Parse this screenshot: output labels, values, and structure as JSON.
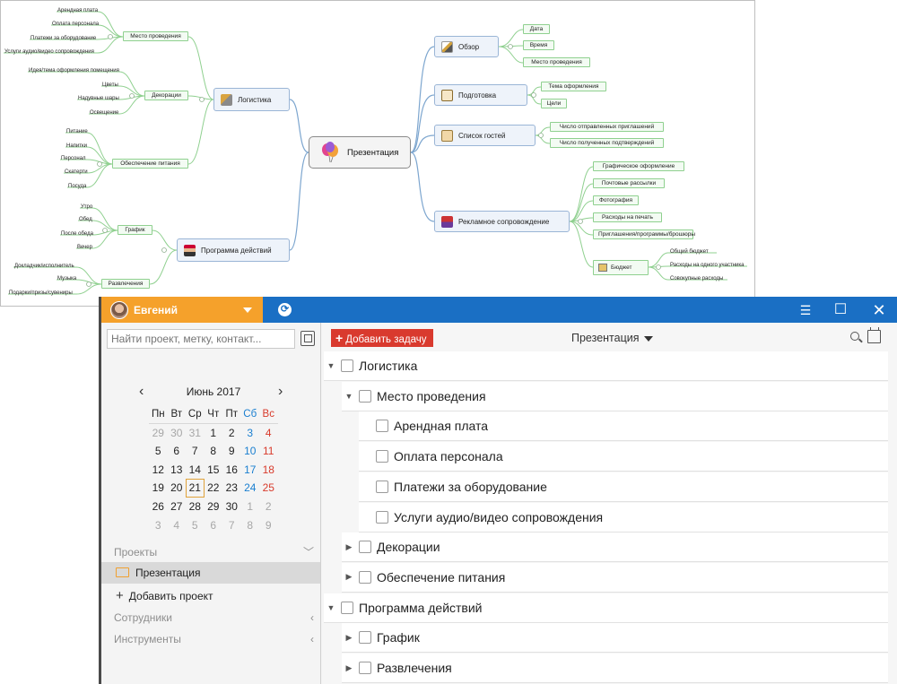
{
  "mindmap": {
    "center": "Презентация",
    "left_branches": [
      {
        "label": "Логистика",
        "groups": [
          {
            "label": "Место проведения",
            "leaves": [
              "Арендная плата",
              "Оплата персонала",
              "Платежи за оборудование",
              "Услуги аудио/видео сопровождения"
            ]
          },
          {
            "label": "Декорации",
            "leaves": [
              "Идея/тема оформления помещения",
              "Цветы",
              "Надувные шары",
              "Освещение"
            ]
          },
          {
            "label": "Обеспечение питания",
            "leaves": [
              "Питание",
              "Напитки",
              "Персонал",
              "Скатерти",
              "Посуда"
            ]
          }
        ]
      },
      {
        "label": "Программа действий",
        "groups": [
          {
            "label": "График",
            "leaves": [
              "Утро",
              "Обед",
              "После обеда",
              "Вечер"
            ]
          },
          {
            "label": "Развлечения",
            "leaves": [
              "Докладчик/исполнитель",
              "Музыка",
              "Подарки/призы/сувениры"
            ]
          }
        ]
      }
    ],
    "right_branches": [
      {
        "label": "Обзор",
        "leaves": [
          "Дата",
          "Время",
          "Место проведения"
        ]
      },
      {
        "label": "Подготовка",
        "leaves": [
          "Тема оформления",
          "Цели"
        ]
      },
      {
        "label": "Список гостей",
        "leaves": [
          "Число отправленных приглашений",
          "Число полученных подтверждений"
        ]
      },
      {
        "label": "Рекламное сопровождение",
        "leaves": [
          "Графическое оформление",
          "Почтовые рассылки",
          "Фотография",
          "Расходы на печать",
          "Приглашения/программы/брошюры",
          "Бюджет"
        ],
        "budget_leaves": [
          "Общий бюджет",
          "Расходы на одного участника",
          "Совокупные расходы"
        ]
      }
    ]
  },
  "app": {
    "user_name": "Евгений",
    "sidebar": {
      "search_placeholder": "Найти проект, метку, контакт...",
      "calendar": {
        "month_label": "Июнь 2017",
        "weekdays": [
          "Пн",
          "Вт",
          "Ср",
          "Чт",
          "Пт",
          "Сб",
          "Вс"
        ],
        "weeks": [
          [
            "29",
            "30",
            "31",
            "1",
            "2",
            "3",
            "4"
          ],
          [
            "5",
            "6",
            "7",
            "8",
            "9",
            "10",
            "11"
          ],
          [
            "12",
            "13",
            "14",
            "15",
            "16",
            "17",
            "18"
          ],
          [
            "19",
            "20",
            "21",
            "22",
            "23",
            "24",
            "25"
          ],
          [
            "26",
            "27",
            "28",
            "29",
            "30",
            "1",
            "2"
          ],
          [
            "3",
            "4",
            "5",
            "6",
            "7",
            "8",
            "9"
          ]
        ],
        "today": "21"
      },
      "projects_header": "Проекты",
      "active_project": "Презентация",
      "add_project": "Добавить проект",
      "employees_header": "Сотрудники",
      "tools_header": "Инструменты"
    },
    "toolbar": {
      "add_task": "Добавить задачу",
      "project_select": "Презентация"
    },
    "tasks": [
      {
        "label": "Логистика",
        "level": 0,
        "expanded": true
      },
      {
        "label": "Место проведения",
        "level": 1,
        "expanded": true
      },
      {
        "label": "Арендная плата",
        "level": 2
      },
      {
        "label": "Оплата персонала",
        "level": 2
      },
      {
        "label": "Платежи за оборудование",
        "level": 2
      },
      {
        "label": "Услуги аудио/видео сопровождения",
        "level": 2
      },
      {
        "label": "Декорации",
        "level": 1,
        "expanded": false
      },
      {
        "label": "Обеспечение питания",
        "level": 1,
        "expanded": false
      },
      {
        "label": "Программа действий",
        "level": 0,
        "expanded": true
      },
      {
        "label": "График",
        "level": 1,
        "expanded": false
      },
      {
        "label": "Развлечения",
        "level": 1,
        "expanded": false
      }
    ]
  }
}
